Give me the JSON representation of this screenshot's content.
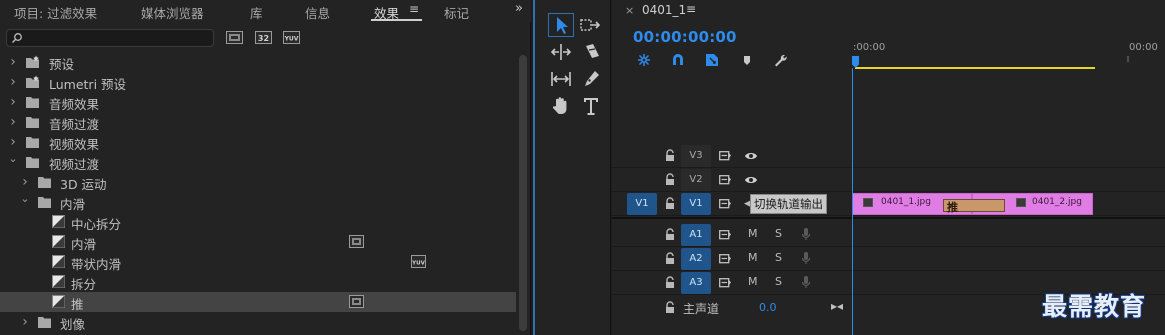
{
  "effects_panel": {
    "tabs": [
      {
        "label": "项目: 过滤效果"
      },
      {
        "label": "媒体浏览器"
      },
      {
        "label": "库"
      },
      {
        "label": "信息"
      },
      {
        "label": "效果"
      },
      {
        "label": "标记"
      }
    ],
    "active_tab": "效果",
    "tab_menu_glyph": "≡",
    "overflow_glyph": "»",
    "search": {
      "value": "",
      "placeholder": ""
    },
    "filter_buttons": [
      "accelerated-effects",
      "32-bit-color",
      "yuv-effects"
    ],
    "tree": [
      {
        "label": "预设",
        "kind": "folder-star",
        "state": "collapsed"
      },
      {
        "label": "Lumetri 预设",
        "kind": "folder-star",
        "state": "collapsed"
      },
      {
        "label": "音频效果",
        "kind": "folder",
        "state": "collapsed"
      },
      {
        "label": "音频过渡",
        "kind": "folder",
        "state": "collapsed"
      },
      {
        "label": "视频效果",
        "kind": "folder",
        "state": "collapsed"
      },
      {
        "label": "视频过渡",
        "kind": "folder",
        "state": "expanded"
      },
      {
        "label": "3D 运动",
        "kind": "folder",
        "state": "collapsed"
      },
      {
        "label": "内滑",
        "kind": "folder",
        "state": "expanded"
      },
      {
        "label": "中心拆分",
        "kind": "transition"
      },
      {
        "label": "内滑",
        "kind": "transition",
        "badge": "accelerated"
      },
      {
        "label": "带状内滑",
        "kind": "transition",
        "badge": "yuv"
      },
      {
        "label": "拆分",
        "kind": "transition"
      },
      {
        "label": "推",
        "kind": "transition",
        "badge": "accelerated",
        "selected": true
      },
      {
        "label": "划像",
        "kind": "folder",
        "state": "collapsed"
      }
    ]
  },
  "tools": [
    "selection-tool",
    "track-select-forward-tool",
    "ripple-edit-tool",
    "razor-tool",
    "slip-tool",
    "pen-tool",
    "hand-tool",
    "type-tool"
  ],
  "timeline": {
    "sequence_name": "0401_1",
    "close_glyph": "×",
    "menu_glyph": "≡",
    "timecode": "00:00:00:00",
    "ruler_labels": [
      ":00:00",
      "00:00"
    ],
    "tracks": [
      {
        "name": "V3",
        "type": "video"
      },
      {
        "name": "V2",
        "type": "video"
      },
      {
        "name": "V1",
        "type": "video",
        "source": "V1",
        "targeted": true
      },
      {
        "name": "A1",
        "type": "audio",
        "mute": "M",
        "solo": "S"
      },
      {
        "name": "A2",
        "type": "audio",
        "mute": "M",
        "solo": "S"
      },
      {
        "name": "A3",
        "type": "audio",
        "mute": "M",
        "solo": "S"
      }
    ],
    "tooltip": "切换轨道输出",
    "clips": [
      {
        "name": "0401_1.jpg"
      },
      {
        "name": "0401_2.jpg"
      }
    ],
    "transition_label": "推",
    "master": {
      "label": "主声道",
      "value": "0.0",
      "end_glyph": "▸◂"
    },
    "colors": {
      "accent": "#2d8ceb",
      "clip": "#e07de5",
      "workarea": "#e8d428",
      "target": "#20558c"
    }
  },
  "watermark": "最需教育"
}
